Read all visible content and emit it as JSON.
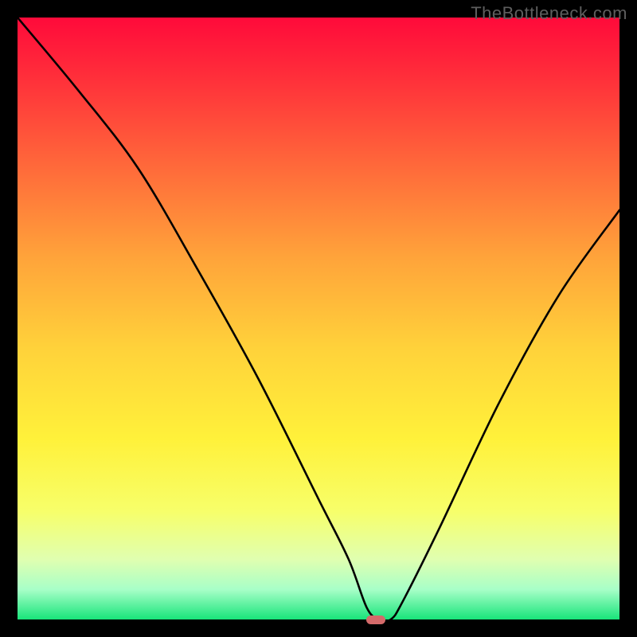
{
  "watermark": "TheBottleneck.com",
  "marker": {
    "x_pct": 59.5
  },
  "chart_data": {
    "type": "line",
    "title": "",
    "xlabel": "",
    "ylabel": "",
    "xlim": [
      0,
      100
    ],
    "ylim": [
      0,
      100
    ],
    "grid": false,
    "background": "rainbow-vertical-red-to-green",
    "series": [
      {
        "name": "bottleneck-curve",
        "x": [
          0,
          10,
          20,
          30,
          40,
          50,
          55,
          58,
          60,
          62,
          64,
          70,
          80,
          90,
          100
        ],
        "values": [
          100,
          88,
          75,
          58,
          40,
          20,
          10,
          2,
          0,
          0,
          3,
          15,
          36,
          54,
          68
        ]
      }
    ],
    "annotations": [
      {
        "type": "marker",
        "x": 60,
        "y": 0,
        "shape": "rounded-rect",
        "color": "#d46a6a"
      }
    ]
  }
}
